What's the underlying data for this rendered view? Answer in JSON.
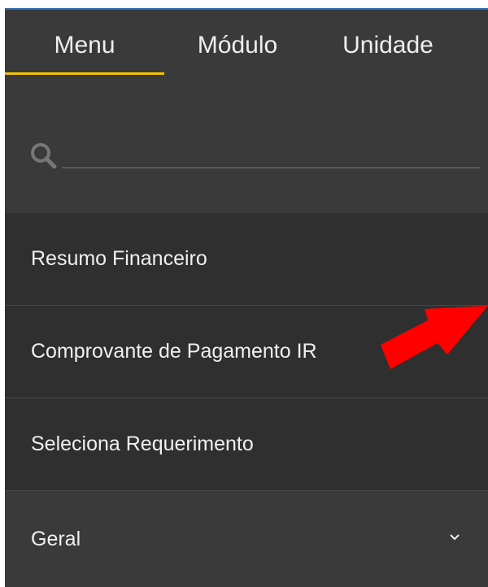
{
  "tabs": [
    {
      "label": "Menu",
      "active": true
    },
    {
      "label": "Módulo"
    },
    {
      "label": "Unidade"
    }
  ],
  "search": {
    "value": "",
    "placeholder": ""
  },
  "menu_items": [
    {
      "label": "Resumo Financeiro"
    },
    {
      "label": "Comprovante de Pagamento IR"
    },
    {
      "label": "Seleciona Requerimento"
    },
    {
      "label": "Geral",
      "expandable": true
    }
  ],
  "colors": {
    "panel_bg": "#3a3a3a",
    "item_bg": "#2f2f2f",
    "accent": "#f2c200",
    "arrow": "#ff0000"
  },
  "icons": {
    "search": "search-icon",
    "expand": "chevron-down-icon",
    "annotation": "red-arrow"
  }
}
